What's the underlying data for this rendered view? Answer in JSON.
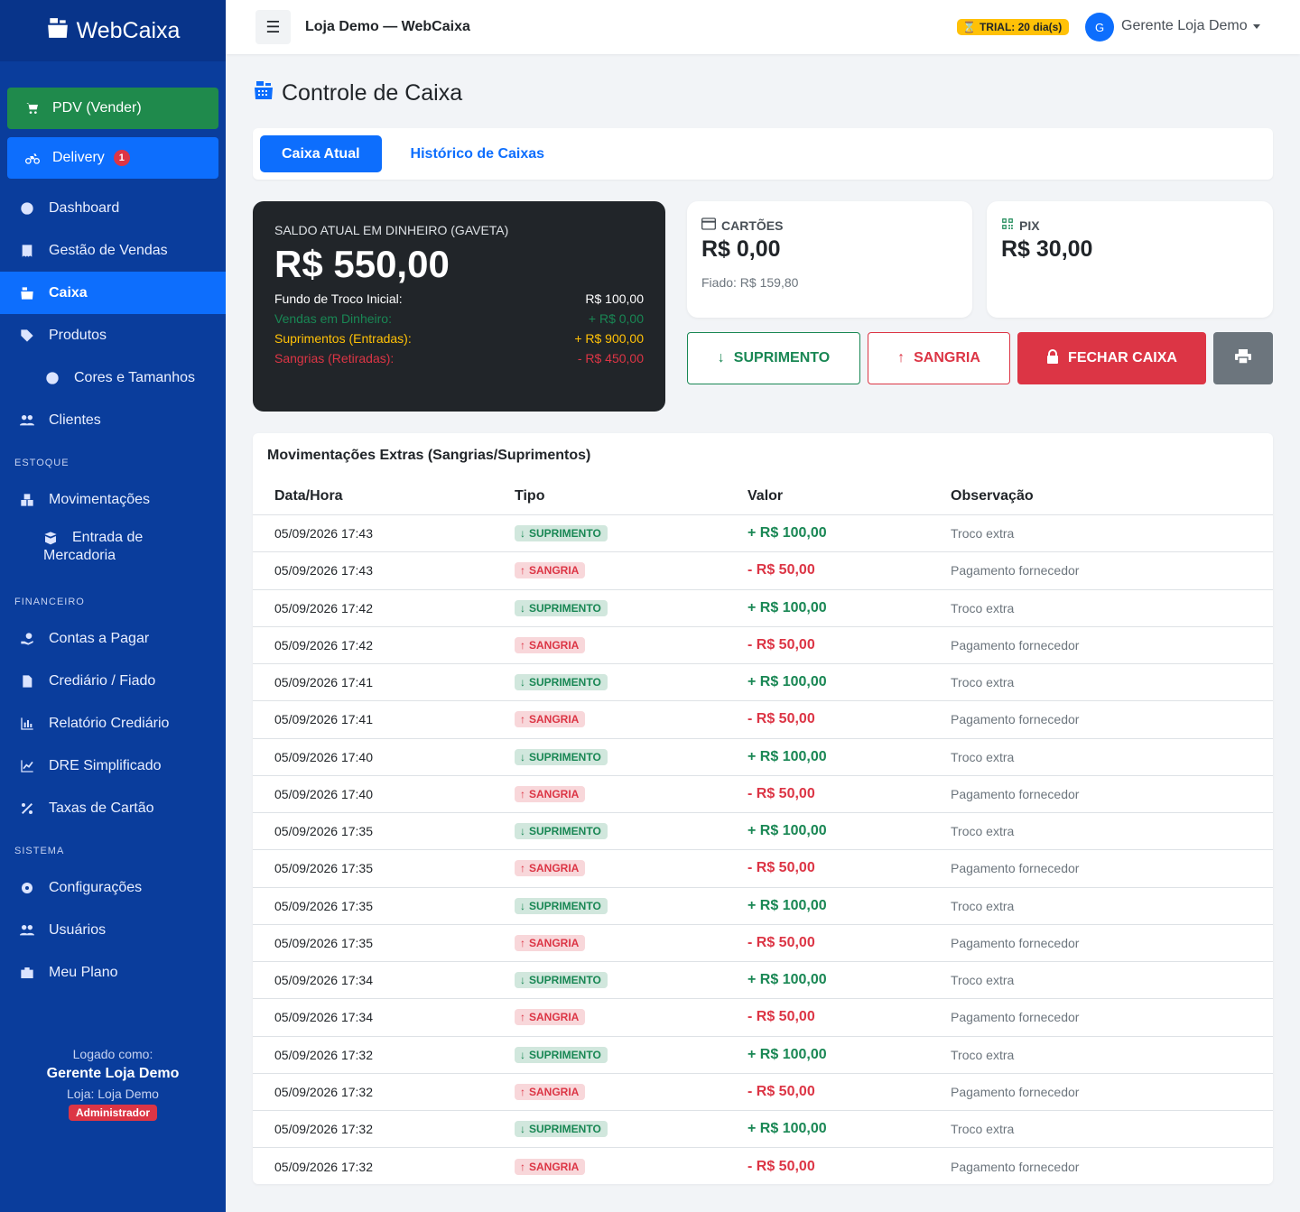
{
  "app": {
    "brand": "WebCaixa",
    "store_title": "Loja Demo — WebCaixa",
    "trial": "TRIAL: 20 dia(s)",
    "avatar_initial": "G",
    "user_menu": "Gerente Loja Demo"
  },
  "sidebar": {
    "pdv_label": "PDV (Vender)",
    "delivery_label": "Delivery",
    "delivery_count": "1",
    "items": [
      {
        "label": "Dashboard"
      },
      {
        "label": "Gestão de Vendas"
      },
      {
        "label": "Caixa"
      },
      {
        "label": "Produtos"
      },
      {
        "label": "Cores e Tamanhos"
      },
      {
        "label": "Clientes"
      }
    ],
    "estoque_label": "ESTOQUE",
    "estoque_items": [
      {
        "label": "Movimentações"
      },
      {
        "label_line1": "Entrada de",
        "label_line2": "Mercadoria"
      }
    ],
    "financeiro_label": "FINANCEIRO",
    "financeiro_items": [
      {
        "label": "Contas a Pagar"
      },
      {
        "label": "Crediário / Fiado"
      },
      {
        "label": "Relatório Crediário"
      },
      {
        "label": "DRE Simplificado"
      },
      {
        "label": "Taxas de Cartão"
      }
    ],
    "sistema_label": "SISTEMA",
    "sistema_items": [
      {
        "label": "Configurações"
      },
      {
        "label": "Usuários"
      },
      {
        "label": "Meu Plano"
      }
    ],
    "logged_as": "Logado como:",
    "user_name": "Gerente Loja Demo",
    "store_line": "Loja: Loja Demo",
    "role": "Administrador"
  },
  "page": {
    "title": "Controle de Caixa",
    "tabs": [
      "Caixa Atual",
      "Histórico de Caixas"
    ]
  },
  "summary": {
    "label": "SALDO ATUAL EM DINHEIRO (GAVETA)",
    "balance": "R$ 550,00",
    "rows": [
      {
        "label": "Fundo de Troco Inicial:",
        "value": "R$ 100,00"
      },
      {
        "label": "Vendas em Dinheiro:",
        "value": "+ R$ 0,00"
      },
      {
        "label": "Suprimentos (Entradas):",
        "value": "+ R$ 900,00"
      },
      {
        "label": "Sangrias (Retiradas):",
        "value": "- R$ 450,00"
      }
    ]
  },
  "cards": {
    "cartoes_label": "CARTÕES",
    "cartoes_value": "R$ 0,00",
    "cartoes_footer": "Fiado: R$ 159,80",
    "pix_label": "PIX",
    "pix_value": "R$ 30,00"
  },
  "actions": {
    "suprimento": "SUPRIMENTO",
    "sangria": "SANGRIA",
    "fechar": "FECHAR CAIXA"
  },
  "table": {
    "title": "Movimentações Extras (Sangrias/Suprimentos)",
    "headers": [
      "Data/Hora",
      "Tipo",
      "Valor",
      "Observação"
    ],
    "rows": [
      {
        "dt": "05/09/2026 17:43",
        "tipo": "SUPRIMENTO",
        "valor": "+ R$ 100,00",
        "obs": "Troco extra"
      },
      {
        "dt": "05/09/2026 17:43",
        "tipo": "SANGRIA",
        "valor": "- R$ 50,00",
        "obs": "Pagamento fornecedor"
      },
      {
        "dt": "05/09/2026 17:42",
        "tipo": "SUPRIMENTO",
        "valor": "+ R$ 100,00",
        "obs": "Troco extra"
      },
      {
        "dt": "05/09/2026 17:42",
        "tipo": "SANGRIA",
        "valor": "- R$ 50,00",
        "obs": "Pagamento fornecedor"
      },
      {
        "dt": "05/09/2026 17:41",
        "tipo": "SUPRIMENTO",
        "valor": "+ R$ 100,00",
        "obs": "Troco extra"
      },
      {
        "dt": "05/09/2026 17:41",
        "tipo": "SANGRIA",
        "valor": "- R$ 50,00",
        "obs": "Pagamento fornecedor"
      },
      {
        "dt": "05/09/2026 17:40",
        "tipo": "SUPRIMENTO",
        "valor": "+ R$ 100,00",
        "obs": "Troco extra"
      },
      {
        "dt": "05/09/2026 17:40",
        "tipo": "SANGRIA",
        "valor": "- R$ 50,00",
        "obs": "Pagamento fornecedor"
      },
      {
        "dt": "05/09/2026 17:35",
        "tipo": "SUPRIMENTO",
        "valor": "+ R$ 100,00",
        "obs": "Troco extra"
      },
      {
        "dt": "05/09/2026 17:35",
        "tipo": "SANGRIA",
        "valor": "- R$ 50,00",
        "obs": "Pagamento fornecedor"
      },
      {
        "dt": "05/09/2026 17:35",
        "tipo": "SUPRIMENTO",
        "valor": "+ R$ 100,00",
        "obs": "Troco extra"
      },
      {
        "dt": "05/09/2026 17:35",
        "tipo": "SANGRIA",
        "valor": "- R$ 50,00",
        "obs": "Pagamento fornecedor"
      },
      {
        "dt": "05/09/2026 17:34",
        "tipo": "SUPRIMENTO",
        "valor": "+ R$ 100,00",
        "obs": "Troco extra"
      },
      {
        "dt": "05/09/2026 17:34",
        "tipo": "SANGRIA",
        "valor": "- R$ 50,00",
        "obs": "Pagamento fornecedor"
      },
      {
        "dt": "05/09/2026 17:32",
        "tipo": "SUPRIMENTO",
        "valor": "+ R$ 100,00",
        "obs": "Troco extra"
      },
      {
        "dt": "05/09/2026 17:32",
        "tipo": "SANGRIA",
        "valor": "- R$ 50,00",
        "obs": "Pagamento fornecedor"
      },
      {
        "dt": "05/09/2026 17:32",
        "tipo": "SUPRIMENTO",
        "valor": "+ R$ 100,00",
        "obs": "Troco extra"
      },
      {
        "dt": "05/09/2026 17:32",
        "tipo": "SANGRIA",
        "valor": "- R$ 50,00",
        "obs": "Pagamento fornecedor"
      }
    ]
  }
}
